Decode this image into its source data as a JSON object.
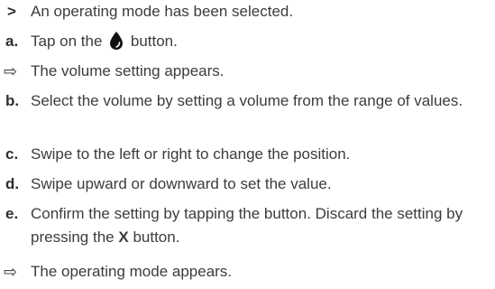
{
  "steps": [
    {
      "marker": ">",
      "text": "An operating mode has been selected."
    },
    {
      "marker": "a.",
      "text_before": "Tap on the",
      "icon": "drop-icon",
      "text_after": "button."
    },
    {
      "marker": "⇨",
      "text": "The volume setting appears."
    },
    {
      "marker": "b.",
      "text": "Select the volume by setting a volume from the range of values."
    },
    {
      "marker": "c.",
      "text": "Swipe to the left or right to change the position."
    },
    {
      "marker": "d.",
      "text": "Swipe upward or downward to set the value."
    },
    {
      "marker": "e.",
      "text_before": "Confirm the setting by tapping the button. Discard the setting by pressing the",
      "bold": "X",
      "text_after": "button."
    },
    {
      "marker": "⇨",
      "text": "The operating mode appears."
    }
  ]
}
